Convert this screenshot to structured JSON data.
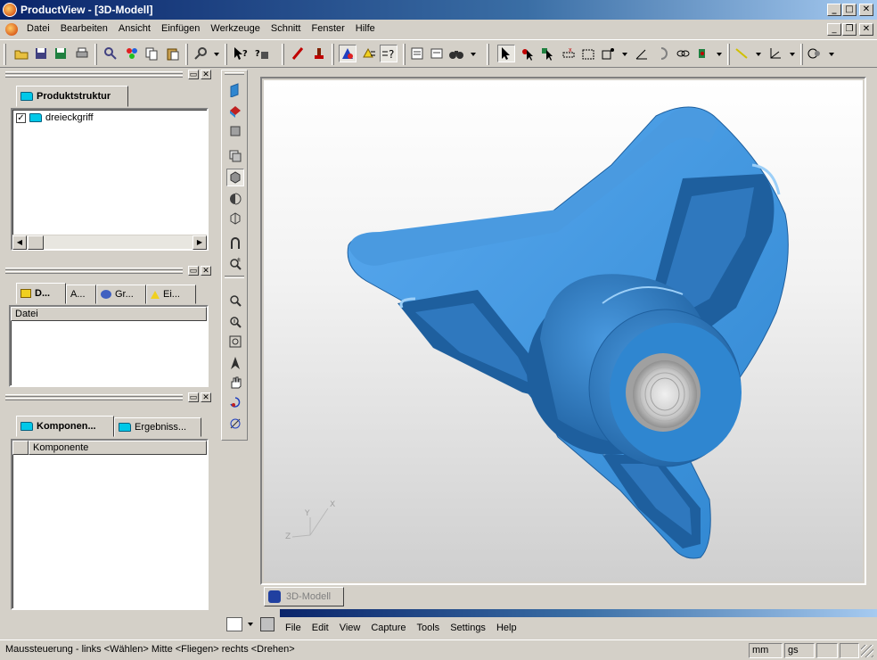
{
  "window": {
    "title": "ProductView - [3D-Modell]",
    "controls": {
      "minimize": "_",
      "maximize": "□",
      "close": "✕"
    }
  },
  "menubar": {
    "items": [
      "Datei",
      "Bearbeiten",
      "Ansicht",
      "Einfügen",
      "Werkzeuge",
      "Schnitt",
      "Fenster",
      "Hilfe"
    ],
    "doc_controls": {
      "minimize": "_",
      "restore": "❐",
      "close": "✕"
    }
  },
  "structure_panel": {
    "tab": "Produktstruktur",
    "tree_item": "dreieckgriff"
  },
  "details_panel": {
    "tabs": [
      "D...",
      "A...",
      "Gr...",
      "Ei..."
    ],
    "column": "Datei"
  },
  "components_panel": {
    "tabs": [
      "Komponen...",
      "Ergebniss..."
    ],
    "column": "Komponente"
  },
  "viewport": {
    "tab": "3D-Modell",
    "axes": {
      "x": "X",
      "y": "Y",
      "z": "Z"
    },
    "colors": {
      "part": "#2f86d0",
      "part_dark": "#1e5f9e",
      "part_light": "#5aaaf0",
      "thread": "#d8d8d8"
    }
  },
  "snagit_menu": {
    "items": [
      "File",
      "Edit",
      "View",
      "Capture",
      "Tools",
      "Settings",
      "Help"
    ]
  },
  "statusbar": {
    "message": "Maussteuerung - links <Wählen> Mitte <Fliegen> rechts <Drehen>",
    "unit": "mm",
    "mode": "gs"
  }
}
